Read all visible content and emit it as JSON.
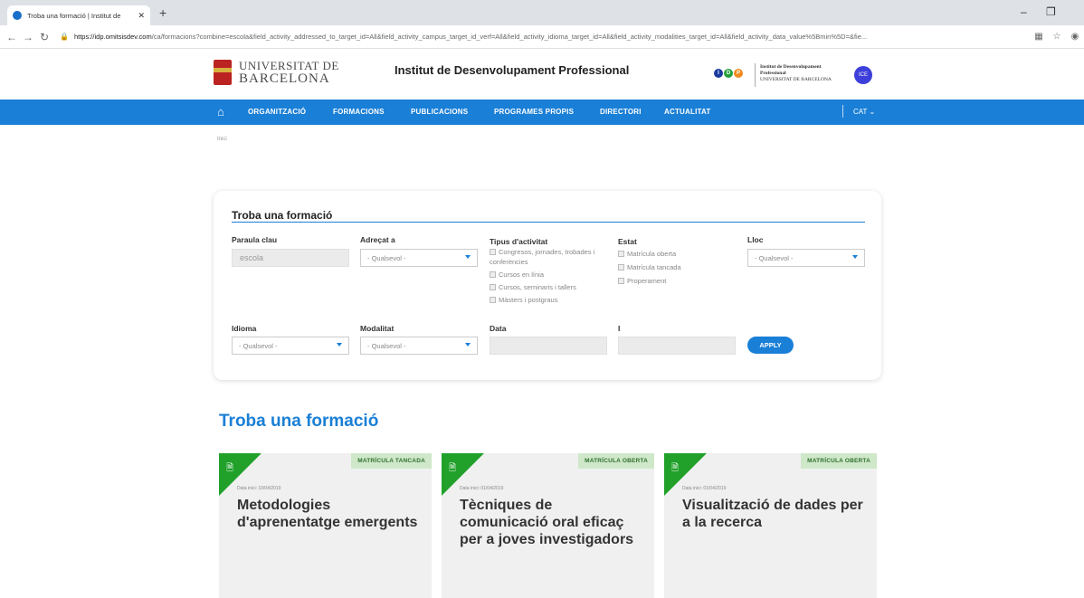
{
  "browser": {
    "tab_title": "Troba una formació | Institut de",
    "tab_close": "✕",
    "new_tab": "+",
    "url_host": "https://idp.omitsisdev.com",
    "url_path": "/ca/formacions?combine=escola&field_activity_addressed_to_target_id=All&field_activity_campus_target_id_verf=All&field_activity_idioma_target_id=All&field_activity_modalities_target_id=All&field_activity_data_value%5Bmin%5D=&fie...",
    "min": "–",
    "restore": "❐"
  },
  "header": {
    "ub_line1": "UNIVERSITAT DE",
    "ub_line2": "BARCELONA",
    "site_title": "Institut de Desenvolupament Professional",
    "idp_letters": [
      "I",
      "D",
      "P"
    ],
    "idp_line1": "Institut de Desenvolupament",
    "idp_line2": "Professional",
    "idp_line3": "UNIVERSITAT DE BARCELONA",
    "ice_label": "ICE"
  },
  "nav": {
    "items": [
      "ORGANITZACIÓ",
      "FORMACIONS",
      "PUBLICACIONS",
      "PROGRAMES PROPIS",
      "DIRECTORI",
      "ACTUALITAT"
    ],
    "lang": "CAT ⌄"
  },
  "breadcrumb": "Inici",
  "filter": {
    "title": "Troba una formació",
    "keyword_label": "Paraula clau",
    "keyword_value": "escola",
    "addressed_label": "Adreçat a",
    "addressed_value": "- Qualsevol -",
    "type_label": "Tipus d'activitat",
    "type_options": [
      "Congresos, jornades, trobades i conferències",
      "Cursos en línia",
      "Cursos, seminaris i tallers",
      "Màsters i postgraus"
    ],
    "status_label": "Estat",
    "status_options": [
      "Matrícula oberta",
      "Matrícula tancada",
      "Properament"
    ],
    "place_label": "Lloc",
    "place_value": "- Qualsevol -",
    "language_label": "Idioma",
    "language_value": "- Qualsevol -",
    "modality_label": "Modalitat",
    "modality_value": "- Qualsevol -",
    "date_label": "Data",
    "and_label": "I",
    "apply_label": "APPLY"
  },
  "results": {
    "heading": "Troba una formació",
    "cards": [
      {
        "status": "MATRÍCULA TANCADA",
        "date": "Data inici: 10/04/2019",
        "title": "Metodologies d'aprenentatge emergents"
      },
      {
        "status": "MATRÍCULA OBERTA",
        "date": "Data inici: 01/04/2019",
        "title": "Tècniques de comunicació oral eficaç per a joves investigadors"
      },
      {
        "status": "MATRÍCULA OBERTA",
        "date": "Data inici: 01/04/2019",
        "title": "Visualització de dades per a la recerca"
      }
    ]
  },
  "colors": {
    "accent": "#1a7fd6",
    "card_corner": "#21a02a",
    "status_bg": "#cfe8c9",
    "idp_dot_1": "#1a3a9e",
    "idp_dot_2": "#23a03a",
    "idp_dot_3": "#f08a1c"
  }
}
